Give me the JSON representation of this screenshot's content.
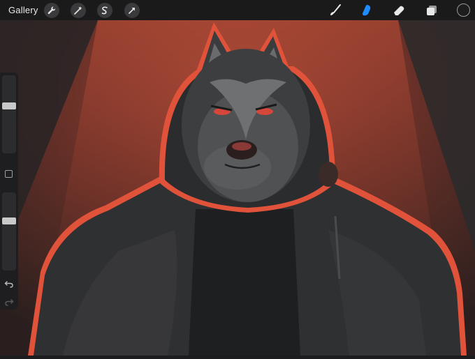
{
  "app": {
    "gallery_label": "Gallery"
  },
  "toolbar_left": [
    {
      "name": "actions-wrench-icon"
    },
    {
      "name": "adjustments-magic-wand-icon"
    },
    {
      "name": "selection-s-icon"
    },
    {
      "name": "transform-arrow-icon"
    }
  ],
  "toolbar_right": [
    {
      "name": "brush-icon",
      "active": false
    },
    {
      "name": "smudge-icon",
      "active": true
    },
    {
      "name": "eraser-icon",
      "active": false
    },
    {
      "name": "layers-icon",
      "active": false
    },
    {
      "name": "color-well",
      "active": false
    }
  ],
  "sidebar": {
    "brush_size_level": 0.62,
    "opacity_level": 0.65,
    "undo_icon": "undo-icon",
    "redo_icon": "redo-icon"
  },
  "colors": {
    "accent_active": "#1f8cff",
    "background_red": "#b04a36",
    "outline_orange": "#e0533a"
  }
}
